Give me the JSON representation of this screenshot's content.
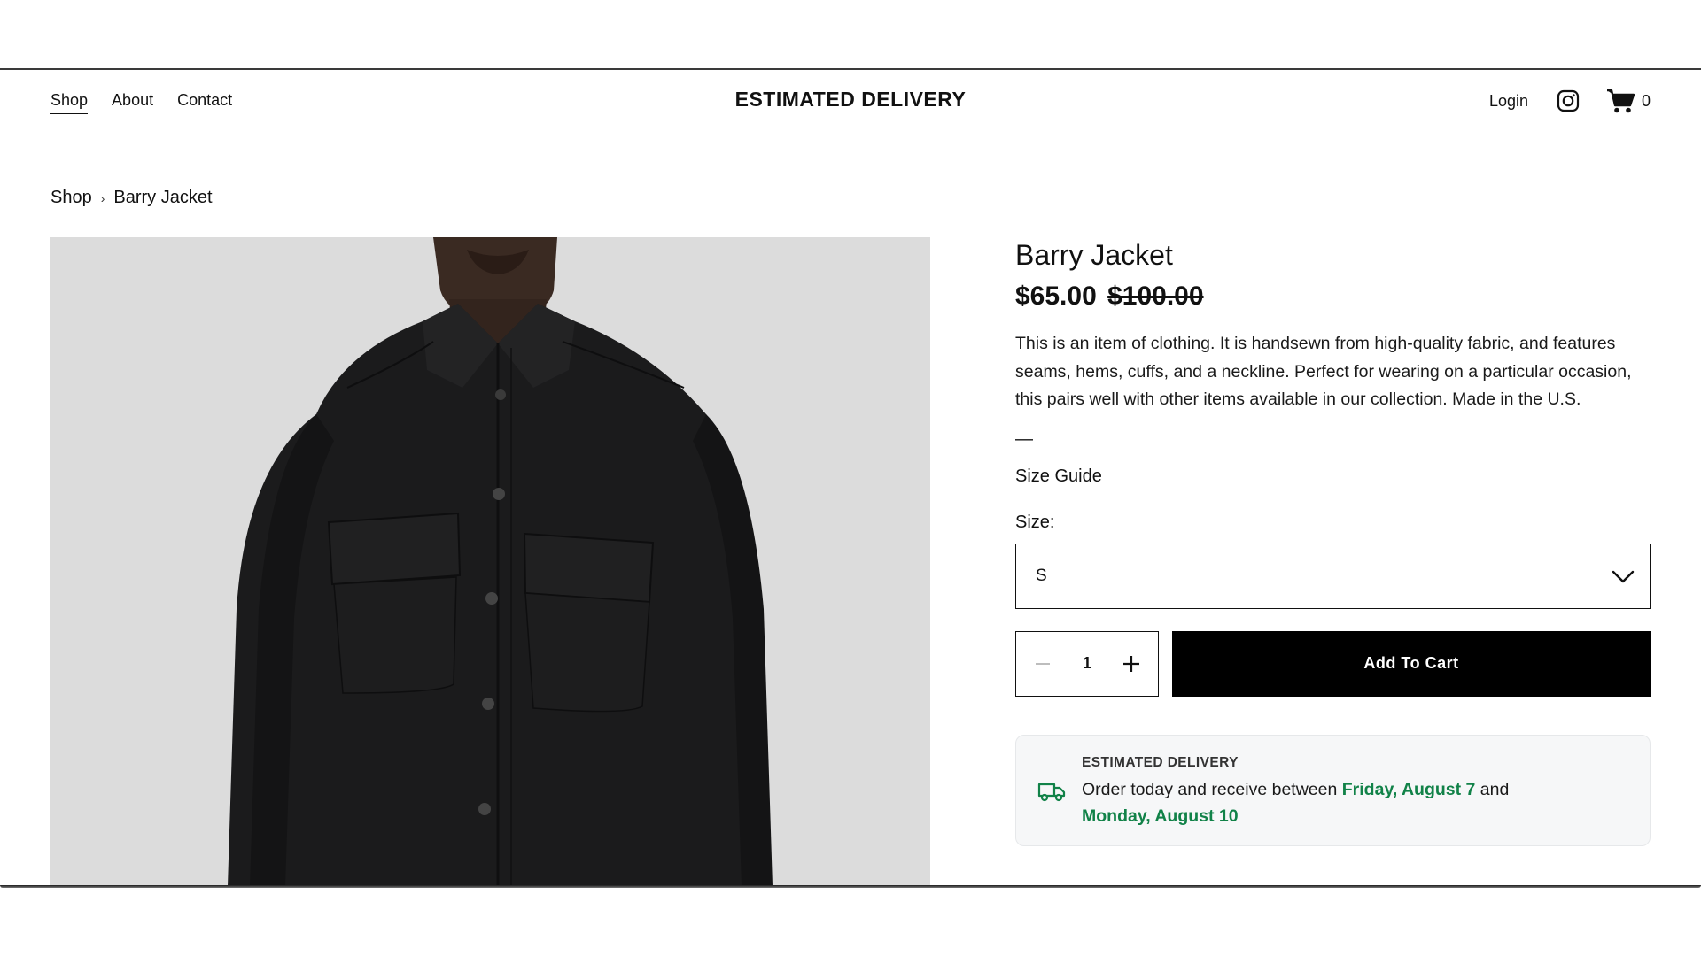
{
  "nav": {
    "links": [
      "Shop",
      "About",
      "Contact"
    ],
    "brand": "ESTIMATED DELIVERY",
    "login": "Login",
    "cart_count": "0"
  },
  "breadcrumb": {
    "parent": "Shop",
    "separator": "›",
    "current": "Barry Jacket"
  },
  "product": {
    "title": "Barry Jacket",
    "price": "$65.00",
    "compare_price": "$100.00",
    "description": "This is an item of clothing. It is handsewn from high-quality fabric, and features seams, hems, cuffs, and a neckline. Perfect for wearing on a particular occasion, this pairs well with other items available in our collection. Made in the U.S.",
    "dash": "—",
    "size_guide": "Size Guide",
    "size_label": "Size:",
    "size_value": "S",
    "quantity": "1",
    "add_to_cart": "Add To Cart"
  },
  "delivery": {
    "title": "ESTIMATED DELIVERY",
    "text_before": "Order today and receive between ",
    "date_from": "Friday, August 7",
    "text_middle": " and ",
    "date_to": "Monday, August 10"
  },
  "colors": {
    "accent_green": "#118248",
    "button_black": "#000000",
    "image_bg": "#dcdcdc"
  },
  "icons": [
    "instagram-icon",
    "cart-icon",
    "chevron-down-icon",
    "minus-icon",
    "plus-icon",
    "truck-icon"
  ]
}
